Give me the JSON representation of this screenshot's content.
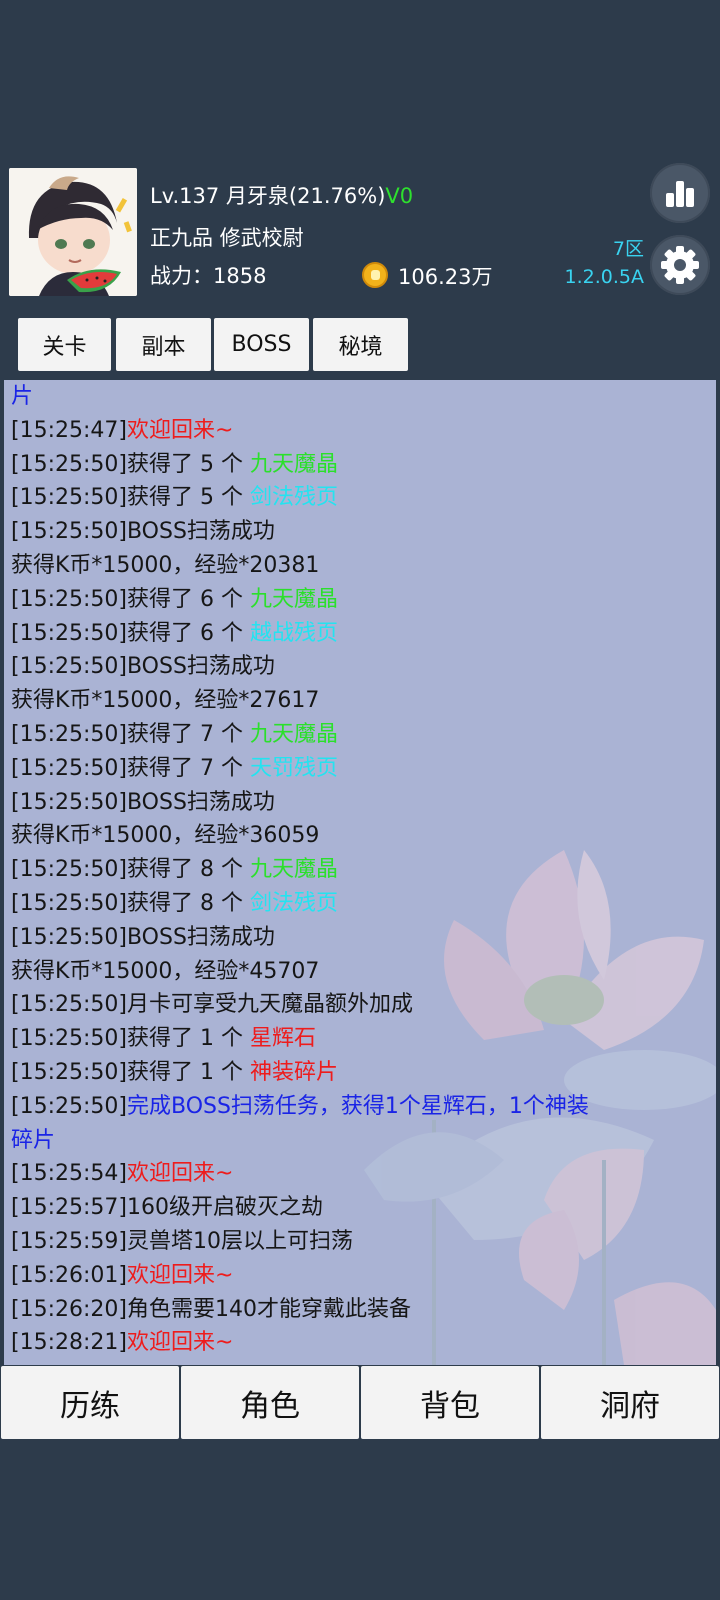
{
  "header": {
    "level_line": "Lv.137 月牙泉(21.76%)",
    "vip": "V0",
    "rank_line": "正九品 修武校尉",
    "power_line": "战力：1858",
    "coins": "106.23万",
    "server": "7区",
    "version": "1.2.0.5A"
  },
  "tabs": [
    "关卡",
    "副本",
    "BOSS",
    "秘境"
  ],
  "log": [
    {
      "segments": [
        {
          "t": "片",
          "c": "blue"
        }
      ]
    },
    {
      "segments": [
        {
          "t": "[15:25:47]",
          "c": "dark"
        },
        {
          "t": "欢迎回来~",
          "c": "red"
        }
      ]
    },
    {
      "segments": [
        {
          "t": "[15:25:50]获得了 5 个 ",
          "c": "dark"
        },
        {
          "t": "九天魔晶",
          "c": "green"
        }
      ]
    },
    {
      "segments": [
        {
          "t": "[15:25:50]获得了 5 个 ",
          "c": "dark"
        },
        {
          "t": "剑法残页",
          "c": "cyan"
        }
      ]
    },
    {
      "segments": [
        {
          "t": "[15:25:50]BOSS扫荡成功",
          "c": "dark"
        }
      ]
    },
    {
      "segments": [
        {
          "t": "获得K币*15000，经验*20381",
          "c": "dark"
        }
      ]
    },
    {
      "segments": [
        {
          "t": "[15:25:50]获得了 6 个 ",
          "c": "dark"
        },
        {
          "t": "九天魔晶",
          "c": "green"
        }
      ]
    },
    {
      "segments": [
        {
          "t": "[15:25:50]获得了 6 个 ",
          "c": "dark"
        },
        {
          "t": "越战残页",
          "c": "cyan"
        }
      ]
    },
    {
      "segments": [
        {
          "t": "[15:25:50]BOSS扫荡成功",
          "c": "dark"
        }
      ]
    },
    {
      "segments": [
        {
          "t": "获得K币*15000，经验*27617",
          "c": "dark"
        }
      ]
    },
    {
      "segments": [
        {
          "t": "[15:25:50]获得了 7 个 ",
          "c": "dark"
        },
        {
          "t": "九天魔晶",
          "c": "green"
        }
      ]
    },
    {
      "segments": [
        {
          "t": "[15:25:50]获得了 7 个 ",
          "c": "dark"
        },
        {
          "t": "天罚残页",
          "c": "cyan"
        }
      ]
    },
    {
      "segments": [
        {
          "t": "[15:25:50]BOSS扫荡成功",
          "c": "dark"
        }
      ]
    },
    {
      "segments": [
        {
          "t": "获得K币*15000，经验*36059",
          "c": "dark"
        }
      ]
    },
    {
      "segments": [
        {
          "t": "[15:25:50]获得了 8 个 ",
          "c": "dark"
        },
        {
          "t": "九天魔晶",
          "c": "green"
        }
      ]
    },
    {
      "segments": [
        {
          "t": "[15:25:50]获得了 8 个 ",
          "c": "dark"
        },
        {
          "t": "剑法残页",
          "c": "cyan"
        }
      ]
    },
    {
      "segments": [
        {
          "t": "[15:25:50]BOSS扫荡成功",
          "c": "dark"
        }
      ]
    },
    {
      "segments": [
        {
          "t": "获得K币*15000，经验*45707",
          "c": "dark"
        }
      ]
    },
    {
      "segments": [
        {
          "t": "[15:25:50]月卡可享受九天魔晶额外加成",
          "c": "dark"
        }
      ]
    },
    {
      "segments": [
        {
          "t": "[15:25:50]获得了 1 个 ",
          "c": "dark"
        },
        {
          "t": "星辉石",
          "c": "red"
        }
      ]
    },
    {
      "segments": [
        {
          "t": "[15:25:50]获得了 1 个 ",
          "c": "dark"
        },
        {
          "t": "神装碎片",
          "c": "red"
        }
      ]
    },
    {
      "segments": [
        {
          "t": "[15:25:50]",
          "c": "dark"
        },
        {
          "t": "完成BOSS扫荡任务，获得1个星辉石，1个神装",
          "c": "blue"
        }
      ]
    },
    {
      "segments": [
        {
          "t": "碎片",
          "c": "blue"
        }
      ]
    },
    {
      "segments": [
        {
          "t": "[15:25:54]",
          "c": "dark"
        },
        {
          "t": "欢迎回来~",
          "c": "red"
        }
      ]
    },
    {
      "segments": [
        {
          "t": "[15:25:57]160级开启破灭之劫",
          "c": "dark"
        }
      ]
    },
    {
      "segments": [
        {
          "t": "[15:25:59]灵兽塔10层以上可扫荡",
          "c": "dark"
        }
      ]
    },
    {
      "segments": [
        {
          "t": "[15:26:01]",
          "c": "dark"
        },
        {
          "t": "欢迎回来~",
          "c": "red"
        }
      ]
    },
    {
      "segments": [
        {
          "t": "[15:26:20]角色需要140才能穿戴此装备",
          "c": "dark"
        }
      ]
    },
    {
      "segments": [
        {
          "t": "[15:28:21]",
          "c": "dark"
        },
        {
          "t": "欢迎回来~",
          "c": "red"
        }
      ]
    }
  ],
  "bottom_nav": [
    "历练",
    "角色",
    "背包",
    "洞府"
  ],
  "icons": {
    "stats": "bar-chart-icon",
    "settings": "gear-icon",
    "coin": "coin-icon"
  },
  "colors": {
    "bg": "#2d3b4b",
    "log_bg": "#aab3d4",
    "red": "#ee1c1c",
    "green": "#2be02b",
    "cyan": "#24e3f0",
    "blue": "#1a24e6"
  }
}
